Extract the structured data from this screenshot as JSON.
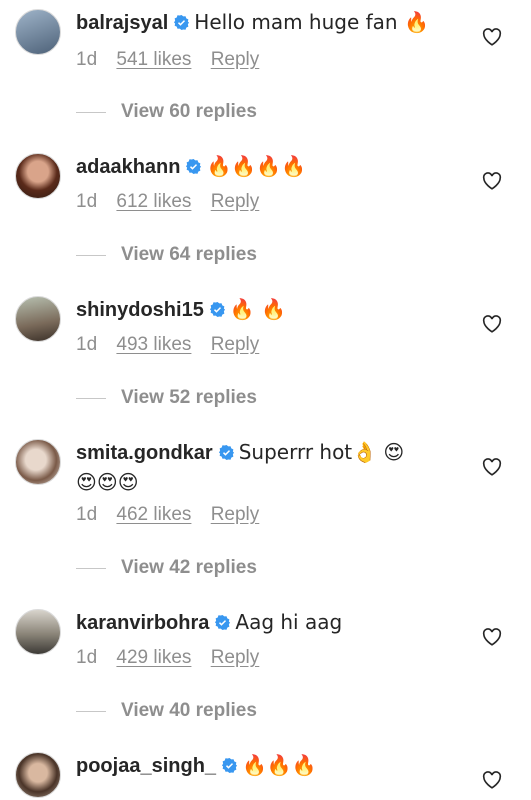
{
  "comments": [
    {
      "username": "balrajsyal",
      "text": "Hello mam huge fan 🔥",
      "time": "1d",
      "likes": "541 likes",
      "reply": "Reply",
      "view_replies": "View 60 replies",
      "avatar_color": "#7a8fa8"
    },
    {
      "username": "adaakhann",
      "text": "🔥🔥🔥🔥",
      "time": "1d",
      "likes": "612 likes",
      "reply": "Reply",
      "view_replies": "View 64 replies",
      "avatar_color": "#6b3b2a"
    },
    {
      "username": "shinydoshi15",
      "text": "🔥 🔥",
      "time": "1d",
      "likes": "493 likes",
      "reply": "Reply",
      "view_replies": "View 52 replies",
      "avatar_color": "#8a7a6a"
    },
    {
      "username": "smita.gondkar",
      "text": "Superrr hot👌 😍",
      "text_line2": "😍😍😍",
      "time": "1d",
      "likes": "462 likes",
      "reply": "Reply",
      "view_replies": "View 42 replies",
      "avatar_color": "#c9b8a8"
    },
    {
      "username": "karanvirbohra",
      "text": "Aag hi aag",
      "time": "1d",
      "likes": "429 likes",
      "reply": "Reply",
      "view_replies": "View 40 replies",
      "avatar_color": "#8d8d8d"
    },
    {
      "username": "poojaa_singh_",
      "text": "🔥🔥🔥",
      "avatar_color": "#5a4236"
    }
  ],
  "colors": {
    "verified_blue": "#3897f0",
    "muted": "#8e8e8e",
    "text": "#262626"
  },
  "icons": {
    "verified": "verified-badge-icon",
    "like": "heart-outline-icon"
  }
}
